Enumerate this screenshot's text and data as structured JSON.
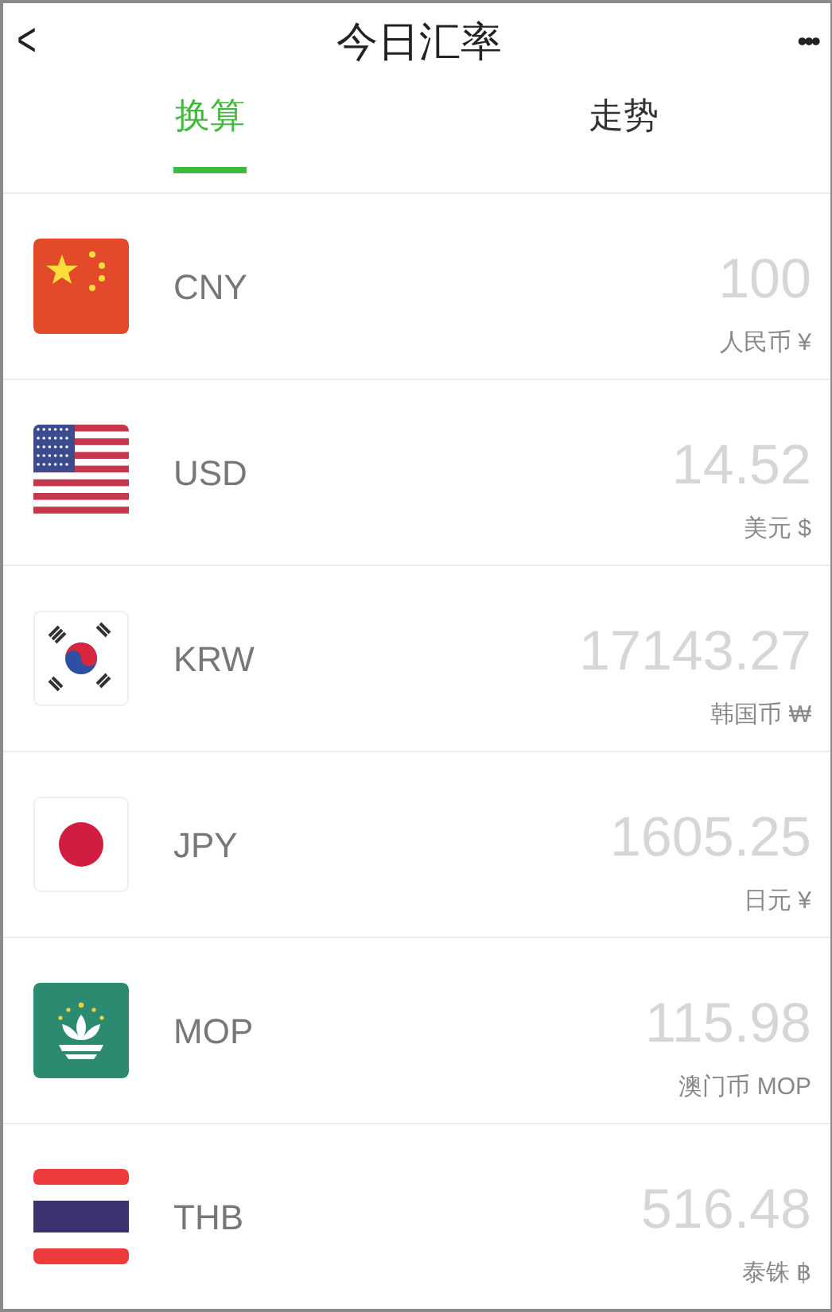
{
  "header": {
    "back": "<",
    "title": "今日汇率",
    "more": "•••"
  },
  "tabs": [
    {
      "label": "换算",
      "selected": true
    },
    {
      "label": "走势",
      "selected": false
    }
  ],
  "currencies": [
    {
      "kind": "cn",
      "code": "CNY",
      "amount": "100",
      "name": "人民币 ¥"
    },
    {
      "kind": "us",
      "code": "USD",
      "amount": "14.52",
      "name": "美元 $"
    },
    {
      "kind": "kr",
      "code": "KRW",
      "amount": "17143.27",
      "name": "韩国币 ₩"
    },
    {
      "kind": "jp",
      "code": "JPY",
      "amount": "1605.25",
      "name": "日元 ¥"
    },
    {
      "kind": "mo",
      "code": "MOP",
      "amount": "115.98",
      "name": "澳门币 MOP"
    },
    {
      "kind": "th",
      "code": "THB",
      "amount": "516.48",
      "name": "泰铢 ฿"
    }
  ]
}
